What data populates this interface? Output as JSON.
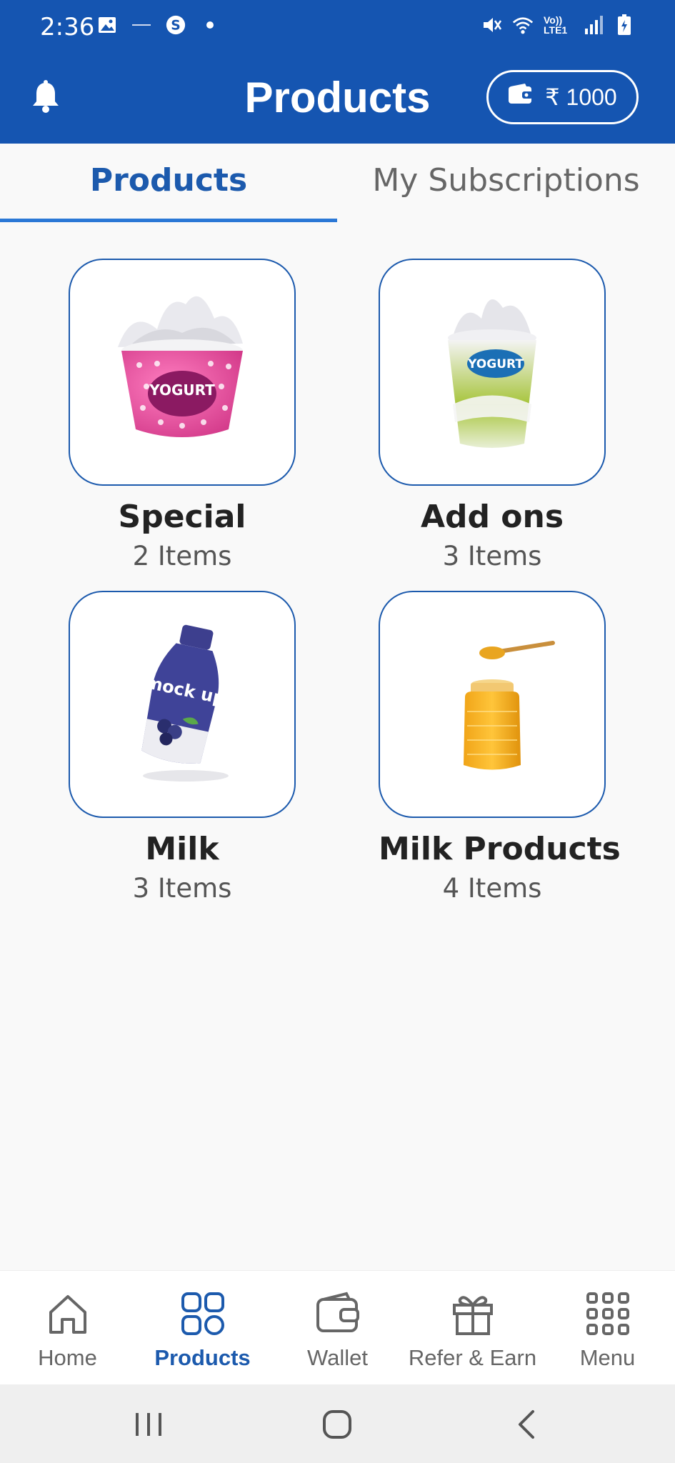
{
  "status_bar": {
    "time": "2:36",
    "icons": [
      "gallery-icon",
      "small-text-icon",
      "skype-icon",
      "dot-icon",
      "mute-icon",
      "wifi-icon",
      "volte-icon",
      "signal-icon",
      "battery-icon"
    ],
    "volte_text": "Vo)) LTE1"
  },
  "header": {
    "title": "Products",
    "wallet_balance": "₹ 1000"
  },
  "tabs": [
    {
      "label": "Products",
      "active": true
    },
    {
      "label": "My Subscriptions",
      "active": false
    }
  ],
  "categories": [
    {
      "name": "Special",
      "count": "2 Items",
      "image": "pink-yogurt-cup",
      "image_text": "YOGURT"
    },
    {
      "name": "Add ons",
      "count": "3 Items",
      "image": "green-yogurt-cup",
      "image_text": "YOGURT"
    },
    {
      "name": "Milk",
      "count": "3 Items",
      "image": "blue-milk-bottle",
      "image_text": "mock up"
    },
    {
      "name": "Milk Products",
      "count": "4 Items",
      "image": "honey-jar",
      "image_text": ""
    }
  ],
  "bottom_nav": [
    {
      "label": "Home",
      "icon": "home-icon",
      "active": false
    },
    {
      "label": "Products",
      "icon": "grid-icon",
      "active": true
    },
    {
      "label": "Wallet",
      "icon": "wallet-icon",
      "active": false
    },
    {
      "label": "Refer & Earn",
      "icon": "gift-icon",
      "active": false
    },
    {
      "label": "Menu",
      "icon": "menu-dots-icon",
      "active": false
    }
  ],
  "colors": {
    "primary": "#1555b1",
    "accent": "#2b78d6",
    "active_text": "#1c5aad",
    "background": "#f9f9f9"
  }
}
